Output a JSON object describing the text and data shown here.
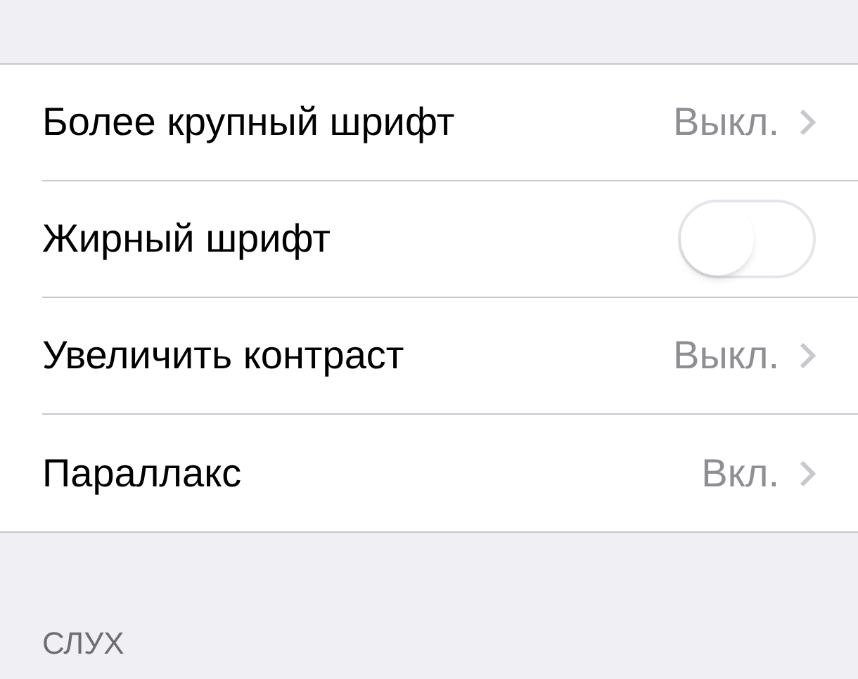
{
  "rows": [
    {
      "kind": "disclosure",
      "label": "Более крупный шрифт",
      "value": "Выкл."
    },
    {
      "kind": "toggle",
      "label": "Жирный шрифт",
      "on": false
    },
    {
      "kind": "disclosure",
      "label": "Увеличить контраст",
      "value": "Выкл."
    },
    {
      "kind": "disclosure",
      "label": "Параллакс",
      "value": "Вкл."
    }
  ],
  "section_header": "СЛУХ"
}
